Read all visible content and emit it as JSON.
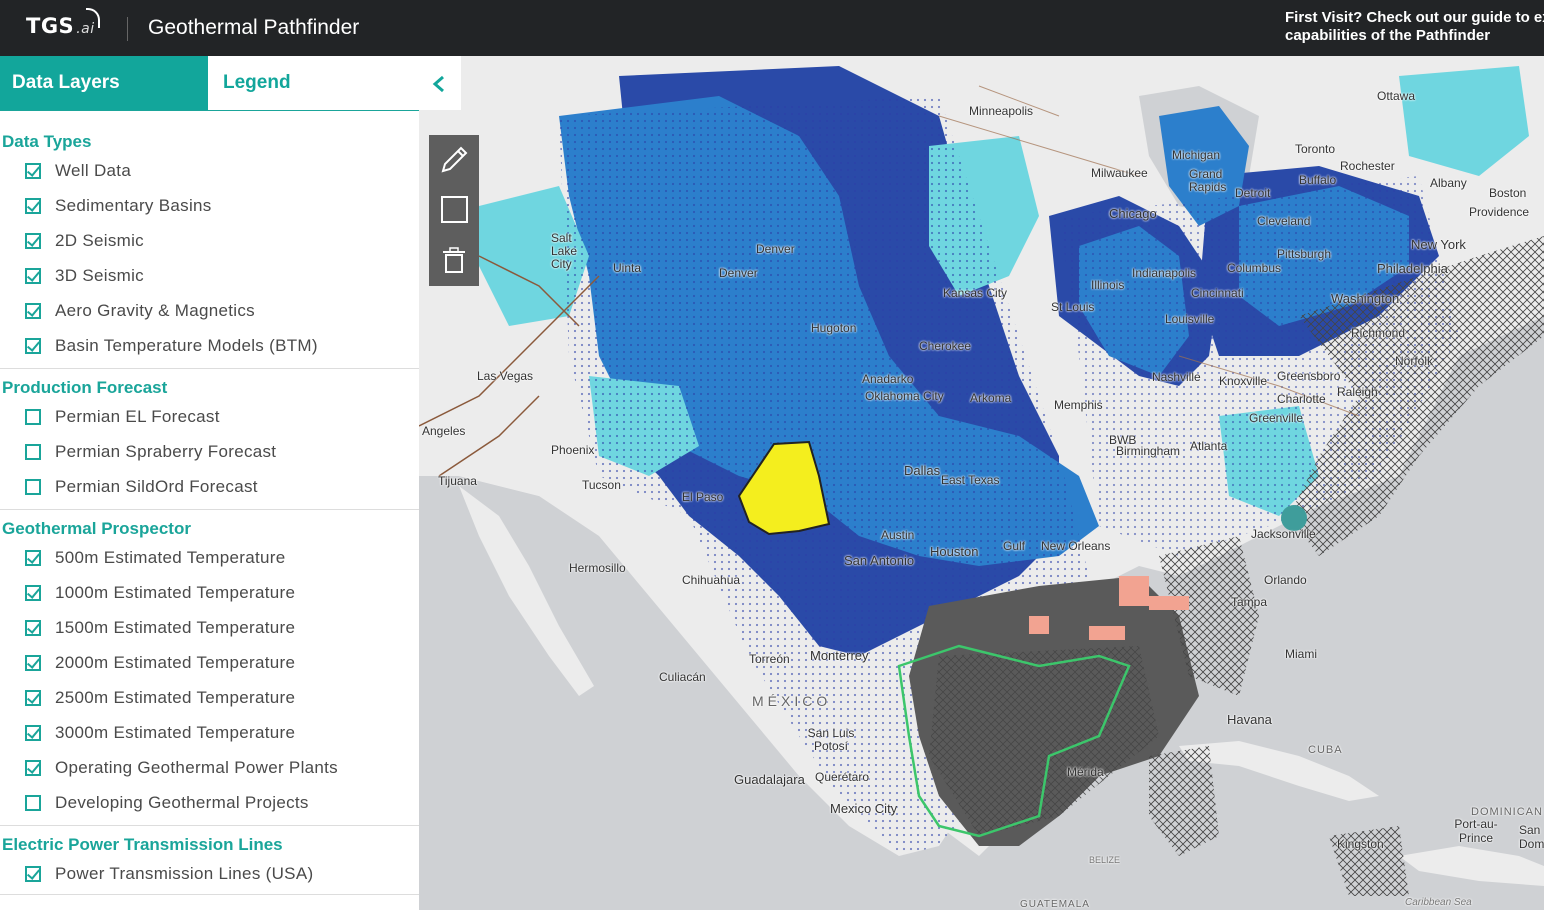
{
  "header": {
    "logo_text": "TGS",
    "logo_suffix": ".ai",
    "app_title": "Geothermal Pathfinder",
    "notice_line1": "First Visit? Check out our guide to ex",
    "notice_line2": "capabilities of the Pathfinder"
  },
  "tabs": {
    "data_layers": "Data Layers",
    "legend": "Legend"
  },
  "icons": {
    "collapse": "chevron-left-icon",
    "draw": "pencil-icon",
    "rectangle": "square-icon",
    "delete": "trash-icon"
  },
  "sections": [
    {
      "title": "Data Types",
      "items": [
        {
          "label": "Well Data",
          "checked": true
        },
        {
          "label": "Sedimentary Basins",
          "checked": true
        },
        {
          "label": "2D Seismic",
          "checked": true
        },
        {
          "label": "3D Seismic",
          "checked": true
        },
        {
          "label": "Aero Gravity & Magnetics",
          "checked": true
        },
        {
          "label": "Basin Temperature Models (BTM)",
          "checked": true
        }
      ]
    },
    {
      "title": "Production Forecast",
      "items": [
        {
          "label": "Permian EL Forecast",
          "checked": false
        },
        {
          "label": "Permian Spraberry Forecast",
          "checked": false
        },
        {
          "label": "Permian SildOrd Forecast",
          "checked": false
        }
      ]
    },
    {
      "title": "Geothermal Prospector",
      "items": [
        {
          "label": "500m Estimated Temperature",
          "checked": true
        },
        {
          "label": "1000m Estimated Temperature",
          "checked": true
        },
        {
          "label": "1500m Estimated Temperature",
          "checked": true
        },
        {
          "label": "2000m Estimated Temperature",
          "checked": true
        },
        {
          "label": "2500m Estimated Temperature",
          "checked": true
        },
        {
          "label": "3000m Estimated Temperature",
          "checked": true
        },
        {
          "label": "Operating Geothermal Power Plants",
          "checked": true
        },
        {
          "label": "Developing Geothermal Projects",
          "checked": false
        }
      ]
    },
    {
      "title": "Electric Power Transmission Lines",
      "items": [
        {
          "label": "Power Transmission Lines (USA)",
          "checked": true
        }
      ]
    }
  ],
  "map_labels": {
    "minneapolis": "Minneapolis",
    "ottawa": "Ottawa",
    "toronto": "Toronto",
    "michigan": "Michigan",
    "milwaukee": "Milwaukee",
    "grand_rapids": "Grand Rapids",
    "detroit": "Detroit",
    "rochester": "Rochester",
    "buffalo": "Buffalo",
    "albany": "Albany",
    "boston": "Boston",
    "providence": "Providence",
    "chicago": "Chicago",
    "cleveland": "Cleveland",
    "new_york": "New York",
    "salt_lake": "Salt Lake City",
    "denver": "Denver",
    "uinta": "Uinta",
    "kansas_city": "Kansas City",
    "indianapolis": "Indianapolis",
    "columbus": "Columbus",
    "pittsburgh": "Pittsburgh",
    "philadelphia": "Philadelphia",
    "illinois": "Illinois",
    "cincinnati": "Cincinnati",
    "washington": "Washington",
    "st_louis": "St Louis",
    "louisville": "Louisville",
    "hugoton": "Hugoton",
    "richmond": "Richmond",
    "las_vegas": "Las Vegas",
    "cherokee": "Cherokee",
    "nashville": "Nashville",
    "knoxville": "Knoxville",
    "greensboro": "Greensboro",
    "norfolk": "Norfolk",
    "anadarko": "Anadarko",
    "oklahoma_city": "Oklahoma City",
    "arkoma": "Arkoma",
    "memphis": "Memphis",
    "charlotte": "Charlotte",
    "raleigh": "Raleigh",
    "los_angeles": "Angeles",
    "phoenix": "Phoenix",
    "greenville": "Greenville",
    "bwb": "BWB",
    "birmingham": "Birmingham",
    "atlanta": "Atlanta",
    "tijuana": "Tijuana",
    "tucson": "Tucson",
    "el_paso": "El Paso",
    "dallas": "Dallas",
    "east_texas": "East Texas",
    "austin": "Austin",
    "houston": "Houston",
    "gulf": "Gulf",
    "new_orleans": "New Orleans",
    "jacksonville": "Jacksonville",
    "san_antonio": "San Antonio",
    "hermosillo": "Hermosillo",
    "chihuahua": "Chihuahua",
    "orlando": "Orlando",
    "tampa": "Tampa",
    "torreon": "Torreón",
    "monterrey": "Monterrey",
    "miami": "Miami",
    "culiacan": "Culiacán",
    "mexico": "MÉXICO",
    "havana": "Havana",
    "san_luis": "San Luis Potosí",
    "cuba": "CUBA",
    "merida": "Mérida",
    "guadalajara": "Guadalajara",
    "queretaro": "Querétaro",
    "mexico_city": "Mexico City",
    "dominican": "DOMINICAN",
    "kingston": "Kingston",
    "port_au_prince": "Port-au-Prince",
    "san_domi": "San Domi",
    "guatemala": "GUATEMALA",
    "caribbean": "Caribbean Sea",
    "belize": "BELIZE"
  },
  "colors": {
    "accent": "#12a69b",
    "header_bg": "#222426",
    "basin_dark": "#2a4aa8",
    "basin_mid": "#2c7fcc",
    "basin_light": "#6fd6e0",
    "seismic": "#5a5a5a",
    "highlight": "#f4ee1e",
    "outline": "#3cc66b"
  }
}
